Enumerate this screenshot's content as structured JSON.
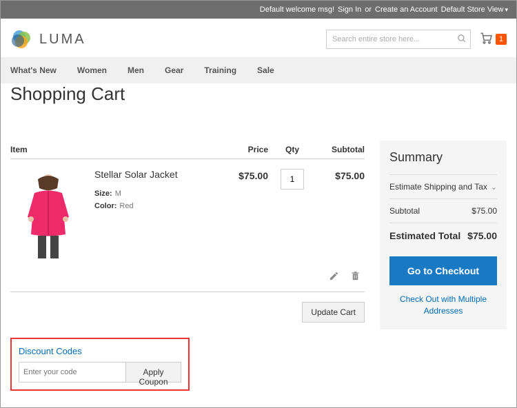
{
  "topbar": {
    "welcome": "Default welcome msg!",
    "signin": "Sign In",
    "or": "or",
    "create": "Create an Account",
    "store_view": "Default Store View"
  },
  "logo_text": "LUMA",
  "search": {
    "placeholder": "Search entire store here..."
  },
  "cart_count": "1",
  "nav": {
    "whats_new": "What's New",
    "women": "Women",
    "men": "Men",
    "gear": "Gear",
    "training": "Training",
    "sale": "Sale"
  },
  "page_title": "Shopping Cart",
  "columns": {
    "item": "Item",
    "price": "Price",
    "qty": "Qty",
    "subtotal": "Subtotal"
  },
  "item": {
    "name": "Stellar Solar Jacket",
    "size_label": "Size:",
    "size": "M",
    "color_label": "Color:",
    "color": "Red",
    "price": "$75.00",
    "qty": "1",
    "subtotal": "$75.00"
  },
  "update_cart": "Update Cart",
  "discount": {
    "title": "Discount Codes",
    "placeholder": "Enter your code",
    "apply": "Apply Coupon"
  },
  "summary": {
    "title": "Summary",
    "estimate": "Estimate Shipping and Tax",
    "subtotal_label": "Subtotal",
    "subtotal": "$75.00",
    "total_label": "Estimated Total",
    "total": "$75.00",
    "checkout": "Go to Checkout",
    "multiship": "Check Out with Multiple Addresses"
  }
}
